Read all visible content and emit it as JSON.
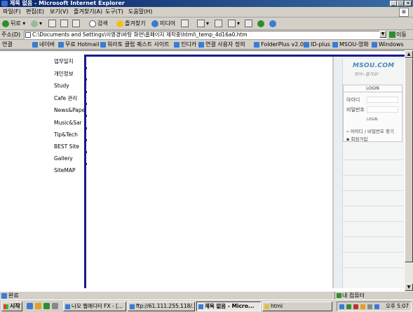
{
  "window": {
    "title": "제목 없음 - Microsoft Internet Explorer",
    "controls": [
      "_",
      "□",
      "×"
    ]
  },
  "menu": {
    "items": [
      "파일(F)",
      "편집(E)",
      "보기(V)",
      "즐겨찾기(A)",
      "도구(T)",
      "도움말(H)"
    ]
  },
  "toolbar": {
    "back_label": "뒤로",
    "search_label": "검색",
    "favorites_label": "즐겨찾기",
    "media_label": "미디어"
  },
  "address": {
    "label": "주소(D)",
    "value": "C:\\Documents and Settings\\이영경\\바탕 화면\\홈페이지 제작중\\html\\_temp_4d16a0.htm",
    "go_label": "이동"
  },
  "links": {
    "label": "연결",
    "items": [
      "네이버",
      "무료 Hotmail",
      "워라토 클럽 퀘스트 사이트",
      "인디카",
      "연결 사용자 정의",
      "FolderPlus v2.0",
      "ID-plus",
      "MSOU-영화",
      "Windows"
    ]
  },
  "page": {
    "nav_items": [
      "업무일지",
      "개인정보",
      "Study",
      "Cafe 관리",
      "News&Paper",
      "Music&Sar",
      "Tip&Tech",
      "BEST Site",
      "Gallery",
      "SiteMAP"
    ],
    "logo": "MSOU.COM",
    "logo_sub": "영어~즐겨요!",
    "login_title": "LOGIN",
    "id_label": "아이디",
    "pw_label": "비밀번호",
    "login_button": "LOGIN",
    "find_link": "아이디 / 비밀번호 찾기",
    "join_link": "회원가입"
  },
  "status": {
    "text": "완료",
    "zone": "내 컴퓨터"
  },
  "taskbar": {
    "start": "시작",
    "tasks": [
      "나모 웹에디터 FX - [...",
      "ftp://61.111.255.118/...",
      "제목 없음 - Micro...",
      "html"
    ],
    "clock": "오후 5:07"
  }
}
